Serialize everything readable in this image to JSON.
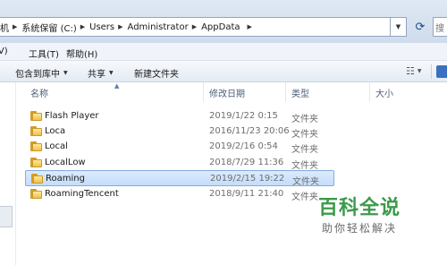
{
  "address_bar": {
    "crumbs": [
      "机",
      "系统保留 (C:)",
      "Users",
      "Administrator",
      "AppData"
    ]
  },
  "menu": {
    "items": [
      "工具(T)",
      "帮助(H)"
    ],
    "partial_item": "(V)"
  },
  "toolbar": {
    "include_library": "包含到库中",
    "share": "共享",
    "new_folder": "新建文件夹"
  },
  "columns": {
    "name": "名称",
    "modified": "修改日期",
    "type": "类型",
    "size": "大小"
  },
  "files": [
    {
      "name": "Flash Player",
      "modified": "2019/1/22 0:15",
      "type": "文件夹",
      "selected": false
    },
    {
      "name": "Loca",
      "modified": "2016/11/23 20:06",
      "type": "文件夹",
      "selected": false
    },
    {
      "name": "Local",
      "modified": "2019/2/16 0:54",
      "type": "文件夹",
      "selected": false
    },
    {
      "name": "LocalLow",
      "modified": "2018/7/29 11:36",
      "type": "文件夹",
      "selected": false
    },
    {
      "name": "Roaming",
      "modified": "2019/2/15 19:22",
      "type": "文件夹",
      "selected": true
    },
    {
      "name": "RoamingTencent",
      "modified": "2018/9/11 21:40",
      "type": "文件夹",
      "selected": false
    }
  ],
  "watermark": {
    "title": "百科全说",
    "subtitle": "助你轻松解决"
  },
  "icons": {
    "folder": "folder-icon",
    "refresh": "refresh-icon",
    "search": "search-icon",
    "views": "view-options-icon"
  },
  "colors": {
    "selection": "#c4ddfb",
    "watermark_green": "#3b9a4a"
  }
}
